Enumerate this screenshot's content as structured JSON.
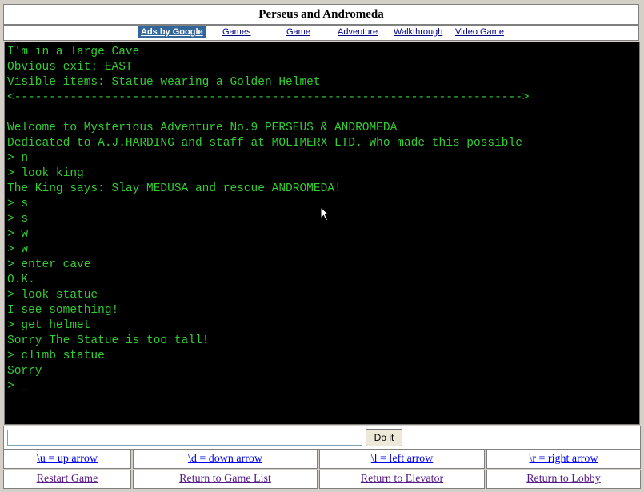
{
  "window": {
    "title": "Perseus and Andromeda"
  },
  "ads": {
    "label": "Ads by Google",
    "links": [
      "Games",
      "Game",
      "Adventure",
      "Walkthrough",
      "Video Game"
    ]
  },
  "console": {
    "lines": [
      "I'm in a large Cave",
      "Obvious exit: EAST",
      "Visible items: Statue wearing a Golden Helmet",
      "<------------------------------------------------------------------------->",
      "",
      "Welcome to Mysterious Adventure No.9 PERSEUS & ANDROMEDA",
      "Dedicated to A.J.HARDING and staff at MOLIMERX LTD. Who made this possible",
      "> n",
      "> look king",
      "The King says: Slay MEDUSA and rescue ANDROMEDA!",
      "> s",
      "> s",
      "> w",
      "> w",
      "> enter cave",
      "O.K.",
      "> look statue",
      "I see something!",
      "> get helmet",
      "Sorry The Statue is too tall!",
      "> climb statue",
      "Sorry",
      "> _"
    ]
  },
  "command": {
    "value": "",
    "placeholder": "",
    "button_label": "Do it"
  },
  "arrows": [
    {
      "label": "\\u = up arrow"
    },
    {
      "label": "\\d = down arrow"
    },
    {
      "label": "\\l = left arrow"
    },
    {
      "label": "\\r = right arrow"
    }
  ],
  "nav": [
    {
      "label": "Restart Game"
    },
    {
      "label": "Return to Game List"
    },
    {
      "label": "Return to Elevator"
    },
    {
      "label": "Return to Lobby"
    }
  ],
  "colors": {
    "console_text": "#33cc33",
    "console_bg": "#000000",
    "ads_label_bg": "#336699"
  }
}
